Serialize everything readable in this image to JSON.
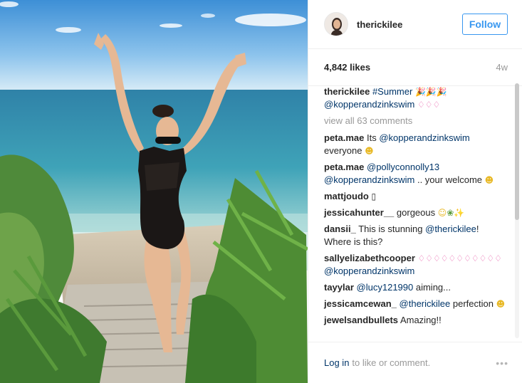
{
  "post": {
    "username": "therickilee",
    "follow_label": "Follow",
    "likes": "4,842 likes",
    "time_ago": "4w"
  },
  "caption": {
    "username": "therickilee",
    "hashtag": "#Summer",
    "mention": "@kopperandzinkswim"
  },
  "view_all": "view all 63 comments",
  "comments": [
    {
      "user": "peta.mae",
      "pre": "Its ",
      "mention": "@kopperandzinkswim",
      "post": " everyone",
      "emoji": "smile"
    },
    {
      "user": "peta.mae",
      "pre": "",
      "mention": "@pollyconnolly13 @kopperandzinkswim",
      "post": " .. your welcome",
      "emoji": "smile"
    },
    {
      "user": "mattjoudo",
      "pre": "",
      "mention": "",
      "post": "",
      "emoji": "box"
    },
    {
      "user": "jessicahunter__",
      "pre": "gorgeous",
      "mention": "",
      "post": "",
      "emoji": "relieved-leaf-sparkle"
    },
    {
      "user": "dansii_",
      "pre": "This is stunning ",
      "mention": "@therickilee",
      "post": "! Where is this?",
      "emoji": ""
    },
    {
      "user": "sallyelizabethcooper",
      "pre": "",
      "mention": "@kopperandzinkswim",
      "post": "",
      "emoji": "bikinis"
    },
    {
      "user": "tayylar",
      "pre": "",
      "mention": "@lucy121990",
      "post": " aiming...",
      "emoji": ""
    },
    {
      "user": "jessicamcewan_",
      "pre": "",
      "mention": "@therickilee",
      "post": " perfection",
      "emoji": "heart-eyes"
    },
    {
      "user": "jewelsandbullets",
      "pre": "Amazing!!",
      "mention": "",
      "post": "",
      "emoji": ""
    }
  ],
  "footer": {
    "login": "Log in",
    "rest": "to like or comment.",
    "more": "•••"
  },
  "colors": {
    "link": "#003569",
    "follow_blue": "#3897f0",
    "muted": "#999999",
    "divider": "#efefef"
  },
  "icons": [
    "party-popper-icon",
    "bikini-icon",
    "smile-icon",
    "heart-eyes-icon",
    "sparkles-icon",
    "herb-icon",
    "more-options-icon"
  ]
}
